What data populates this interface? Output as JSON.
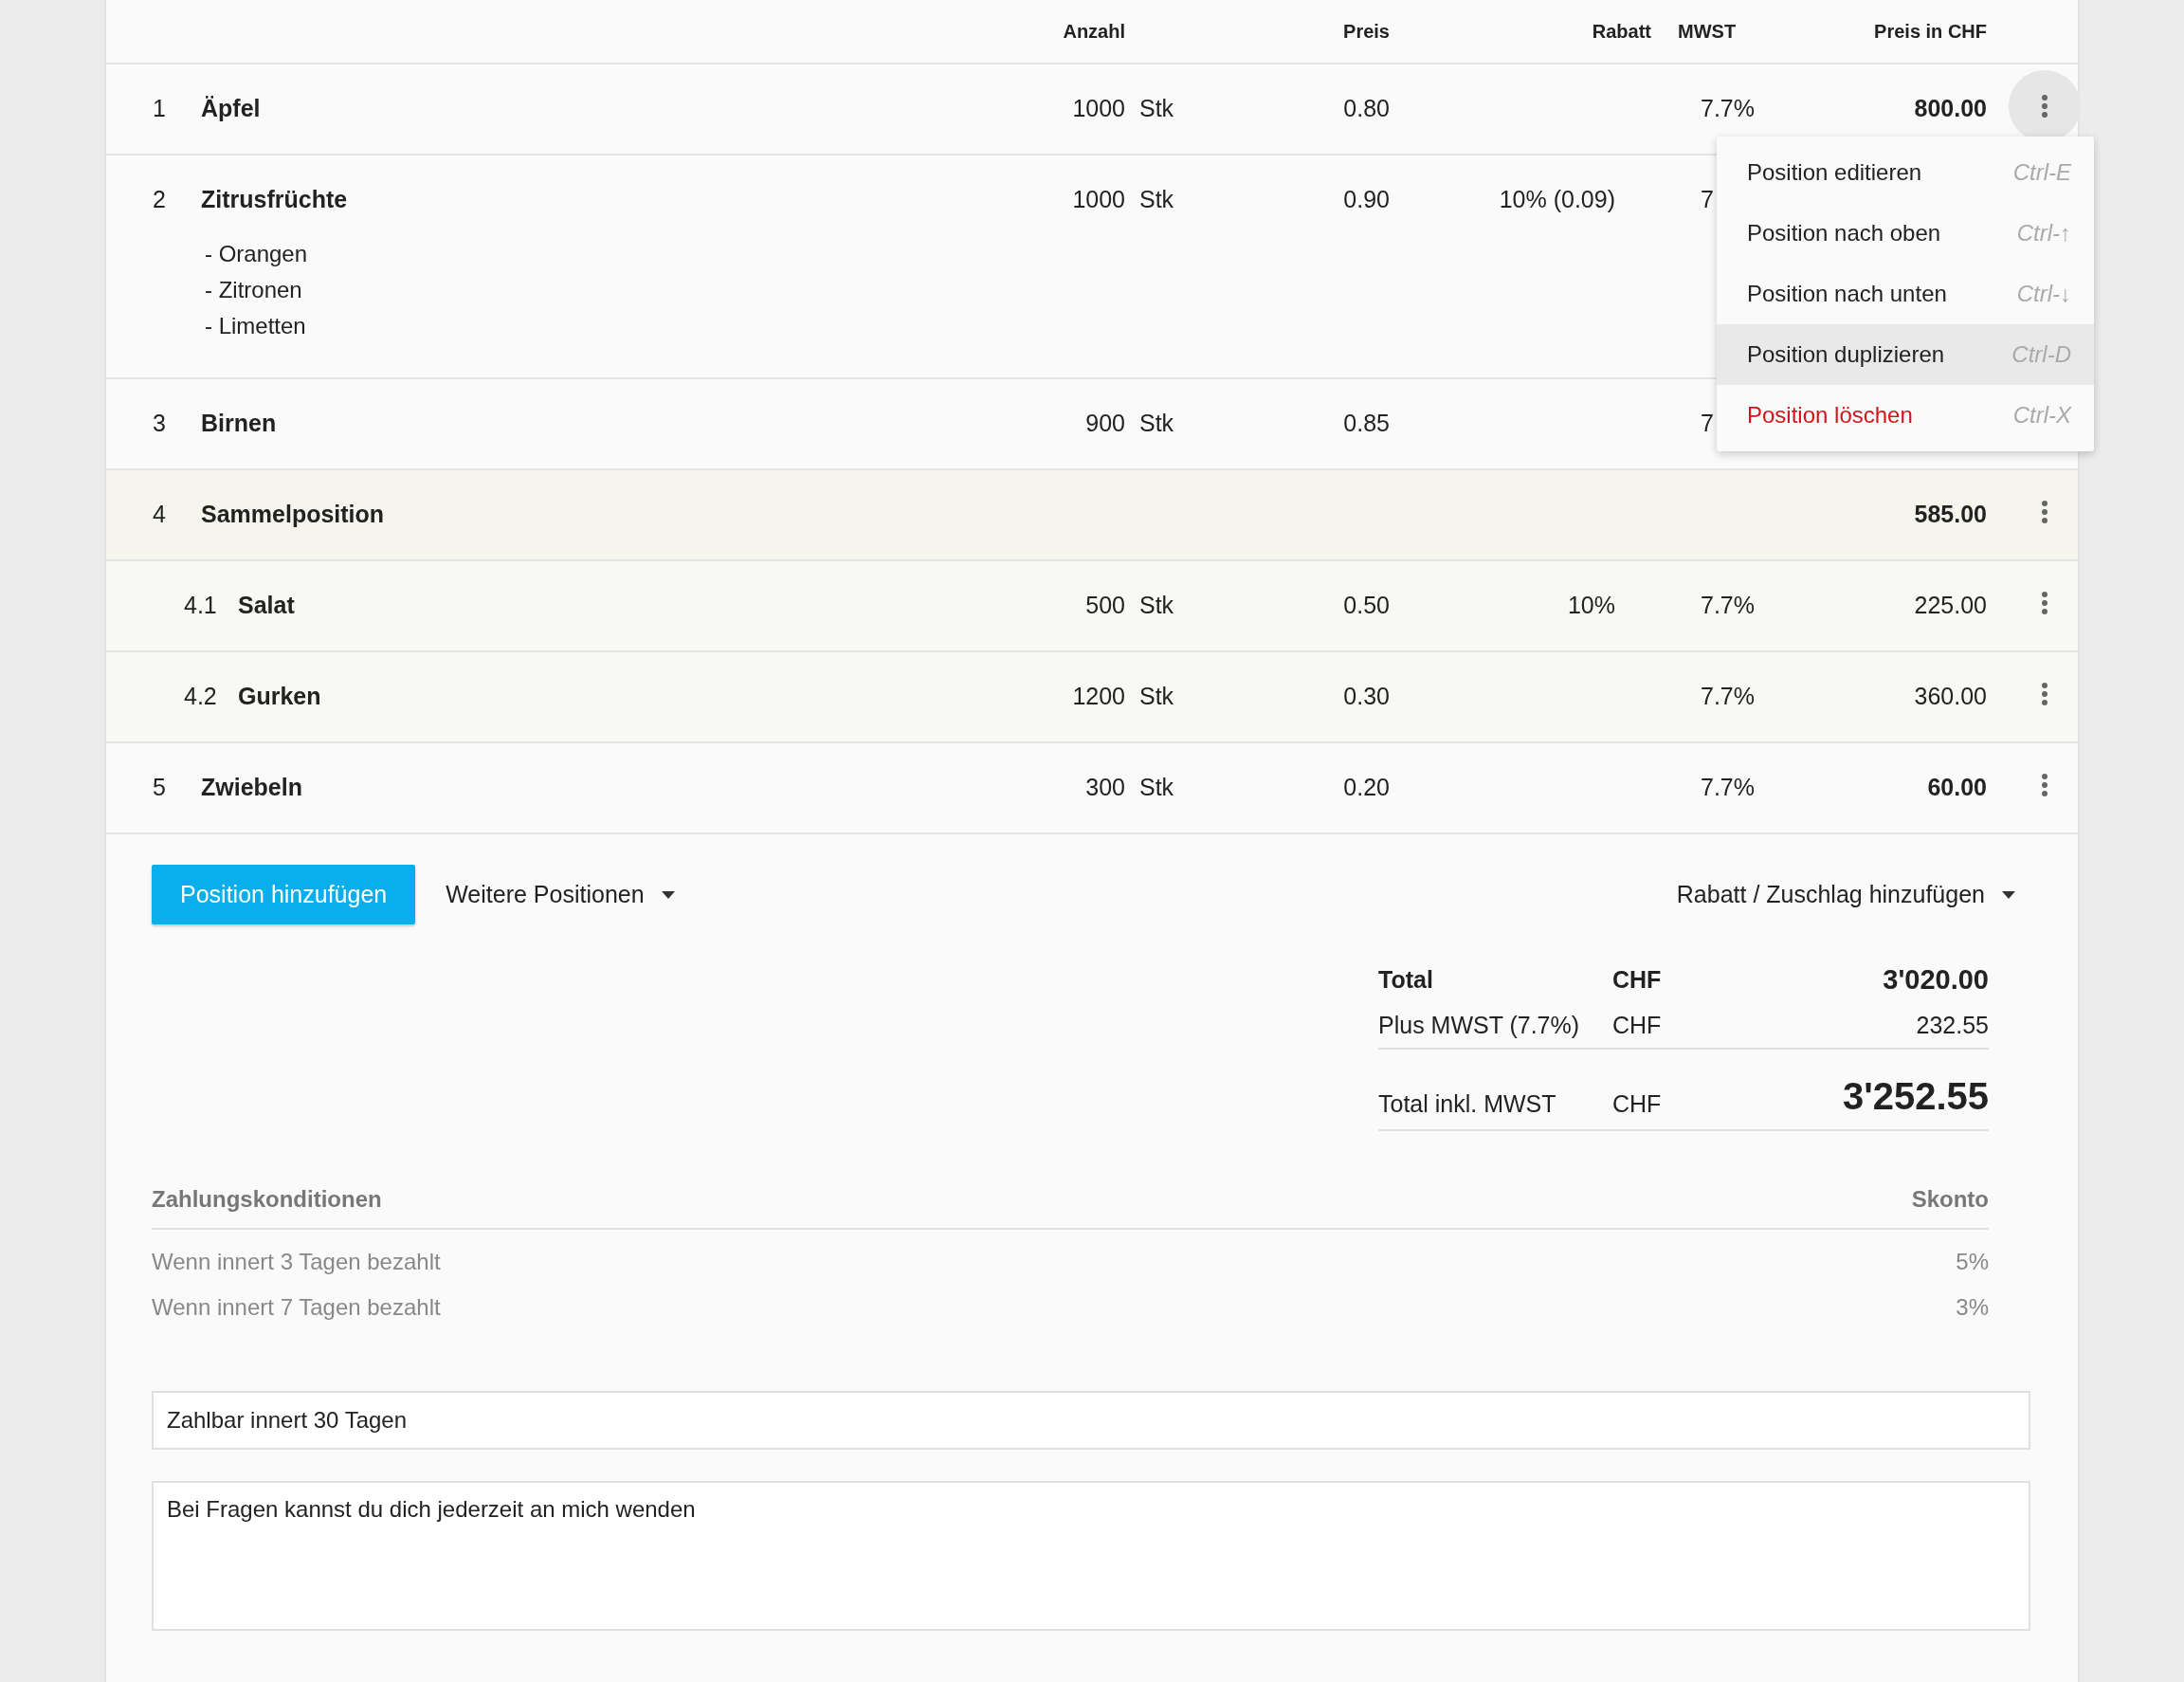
{
  "columns": [
    {
      "label": "Anzahl"
    },
    {
      "label": "Preis"
    },
    {
      "label": "Rabatt"
    },
    {
      "label": "MWST"
    },
    {
      "label": "Preis in CHF"
    }
  ],
  "rows": [
    {
      "kind": "item",
      "number": "1",
      "name": "Äpfel",
      "quantity": "1000",
      "unit": "Stk",
      "price": "0.80",
      "mwst": "7.7%",
      "total": "800.00",
      "menu_open": true
    },
    {
      "kind": "item",
      "number": "2",
      "name": "Zitrusfrüchte",
      "description": [
        "- Orangen",
        "- Zitronen",
        "- Limetten"
      ],
      "quantity": "1000",
      "unit": "Stk",
      "price": "0.90",
      "discount": "10% (0.09)",
      "mwst": "7"
    },
    {
      "kind": "item",
      "number": "3",
      "name": "Birnen",
      "quantity": "900",
      "unit": "Stk",
      "price": "0.85",
      "mwst": "7"
    },
    {
      "kind": "group",
      "number": "4",
      "name": "Sammelposition",
      "total": "585.00",
      "menu_open": false
    },
    {
      "kind": "subitem",
      "number": "4.1",
      "name": "Salat",
      "quantity": "500",
      "unit": "Stk",
      "price": "0.50",
      "discount": "10%",
      "mwst": "7.7%",
      "total": "225.00",
      "menu_open": false
    },
    {
      "kind": "subitem",
      "number": "4.2",
      "name": "Gurken",
      "quantity": "1200",
      "unit": "Stk",
      "price": "0.30",
      "mwst": "7.7%",
      "total": "360.00",
      "menu_open": false
    },
    {
      "kind": "item",
      "number": "5",
      "name": "Zwiebeln",
      "quantity": "300",
      "unit": "Stk",
      "price": "0.20",
      "mwst": "7.7%",
      "total": "60.00",
      "menu_open": false
    }
  ],
  "context_menu": [
    {
      "kind": "normal",
      "label": "Position editieren",
      "shortcut": "Ctrl-E",
      "highlighted": false
    },
    {
      "kind": "normal",
      "label": "Position nach oben",
      "shortcut": "Ctrl-↑",
      "highlighted": false
    },
    {
      "kind": "normal",
      "label": "Position nach unten",
      "shortcut": "Ctrl-↓",
      "highlighted": false
    },
    {
      "kind": "normal",
      "label": "Position duplizieren",
      "shortcut": "Ctrl-D",
      "highlighted": true
    },
    {
      "kind": "danger",
      "label": "Position löschen",
      "shortcut": "Ctrl-X",
      "highlighted": false
    }
  ],
  "actions": {
    "add_button": "Position hinzufügen",
    "more_button": "Weitere Positionen",
    "discount_button": "Rabatt / Zuschlag hinzufügen"
  },
  "totals": [
    {
      "kind": "total",
      "label": "Total",
      "currency": "CHF",
      "value": "3'020.00"
    },
    {
      "kind": "tax",
      "label": "Plus MWST (7.7%)",
      "currency": "CHF",
      "value": "232.55"
    },
    {
      "kind": "grand",
      "label": "Total inkl. MWST",
      "currency": "CHF",
      "value": "3'252.55"
    }
  ],
  "payment_terms": {
    "header": "Zahlungskonditionen",
    "skonto_header": "Skonto",
    "rows": [
      {
        "condition": "Wenn innert 3 Tagen bezahlt",
        "skonto": "5%"
      },
      {
        "condition": "Wenn innert 7 Tagen bezahlt",
        "skonto": "3%"
      }
    ]
  },
  "terms_field": {
    "value": "Zahlbar innert 30 Tagen"
  },
  "note_field": {
    "value": "Bei Fragen kannst du dich jederzeit an mich wenden"
  }
}
